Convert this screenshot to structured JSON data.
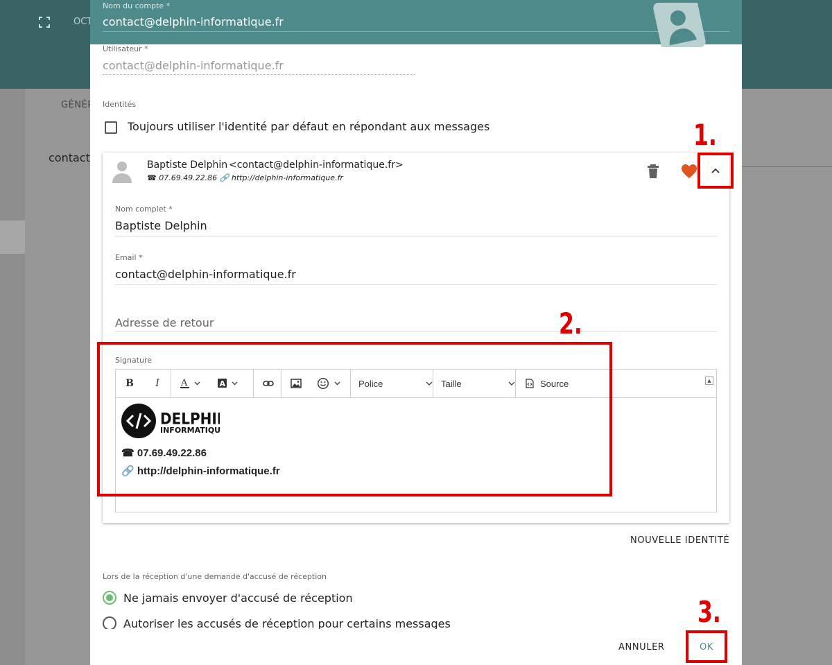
{
  "background": {
    "tab_partial": "OCT",
    "section_partial": "GÉNÉR",
    "field_partial": "contact@"
  },
  "dialog": {
    "account_name_label": "Nom du compte *",
    "account_name_value": "contact@delphin-informatique.fr",
    "user_label": "Utilisateur *",
    "user_value": "contact@delphin-informatique.fr",
    "identities_label": "Identités",
    "always_default_label": "Toujours utiliser l'identité par défaut en répondant aux messages",
    "identity": {
      "name": "Baptiste Delphin",
      "email": "<contact@delphin-informatique.fr>",
      "sub_phone": "☎ 07.69.49.22.86",
      "sub_link": "🔗 http://delphin-informatique.fr",
      "full_name_label": "Nom complet *",
      "full_name_value": "Baptiste Delphin",
      "email_label": "Email *",
      "email_value": "contact@delphin-informatique.fr",
      "reply_placeholder": "Adresse de retour",
      "signature_label": "Signature",
      "toolbar": {
        "bold": "B",
        "italic": "I",
        "font_placeholder": "Police",
        "size_placeholder": "Taille",
        "source_label": "Source"
      },
      "signature": {
        "logo_line1": "DELPHIN",
        "logo_line2": "INFORMATIQUE",
        "phone": "☎ 07.69.49.22.86",
        "url": "🔗 http://delphin-informatique.fr"
      }
    },
    "new_identity_label": "NOUVELLE IDENTITÉ",
    "receipt_label": "Lors de la réception d'une demande d'accusé de réception",
    "receipt_options": [
      "Ne jamais envoyer d'accusé de réception",
      "Autoriser les accusés de réception pour certains messages"
    ],
    "cancel_label": "ANNULER",
    "ok_label": "OK"
  },
  "annotations": [
    "1.",
    "2.",
    "3."
  ],
  "colors": {
    "header": "#4f8a8a",
    "accent_green": "#6fbf73",
    "heart": "#e0541f",
    "annotation_red": "#e00000"
  }
}
